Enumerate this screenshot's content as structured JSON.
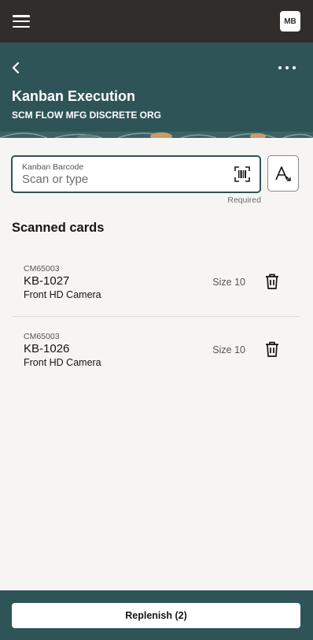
{
  "topbar": {
    "avatar_initials": "MB"
  },
  "header": {
    "title": "Kanban Execution",
    "subtitle": "SCM FLOW MFG DISCRETE ORG"
  },
  "barcode": {
    "label": "Kanban Barcode",
    "placeholder": "Scan or type",
    "helper": "Required"
  },
  "section": {
    "title": "Scanned cards"
  },
  "cards": [
    {
      "code": "CM65003",
      "number": "KB-1027",
      "description": "Front HD Camera",
      "size": "Size 10"
    },
    {
      "code": "CM65003",
      "number": "KB-1026",
      "description": "Front HD Camera",
      "size": "Size 10"
    }
  ],
  "footer": {
    "button_label": "Replenish (2)"
  },
  "colors": {
    "topbar": "#312d2a",
    "header": "#2f5458",
    "background": "#f6f5f3"
  },
  "icons": [
    "hamburger-icon",
    "back-icon",
    "more-icon",
    "barcode-scan-icon",
    "font-size-icon",
    "trash-icon"
  ]
}
